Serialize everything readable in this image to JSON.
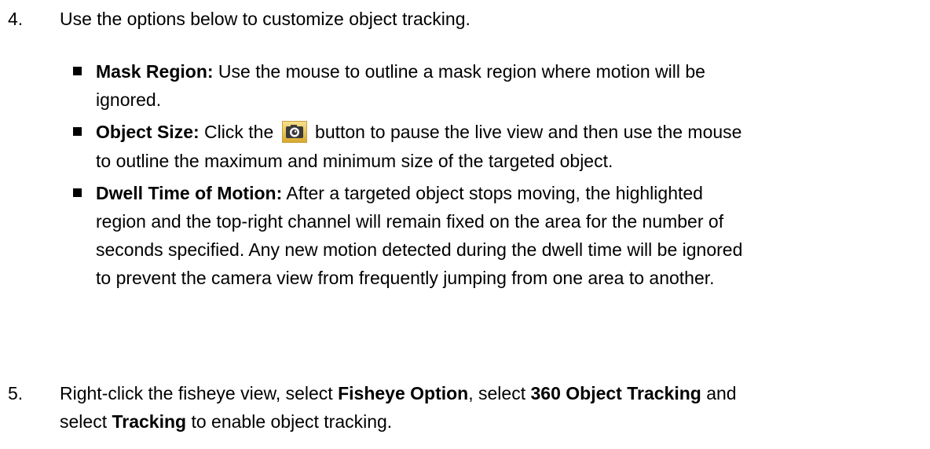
{
  "step4": {
    "number": "4.",
    "text": "Use the options below to customize object tracking."
  },
  "bullets": [
    {
      "label": "Mask Region:",
      "line1": " Use the mouse to outline a mask region where motion will be",
      "line2": "ignored."
    },
    {
      "label": "Object Size:",
      "pre_icon": " Click the ",
      "icon": "camera-snapshot-icon",
      "post_icon": " button to pause the live view and then use the mouse",
      "line2": "to outline the maximum and minimum size of the targeted object."
    },
    {
      "label": "Dwell Time of Motion:",
      "line1": " After a targeted object stops moving, the highlighted",
      "line2": "region and the top-right channel will remain fixed on the area for the number of",
      "line3": "seconds specified. Any new motion detected during the dwell time will be ignored",
      "line4": "to prevent the camera view from frequently jumping from one area to another."
    }
  ],
  "step5": {
    "number": "5.",
    "t1": "Right-click the fisheye view, select ",
    "b1": "Fisheye Option",
    "t2": ", select ",
    "b2": "360 Object Tracking",
    "t3": " and",
    "t4": "select ",
    "b3": "Tracking",
    "t5": " to enable object tracking."
  }
}
